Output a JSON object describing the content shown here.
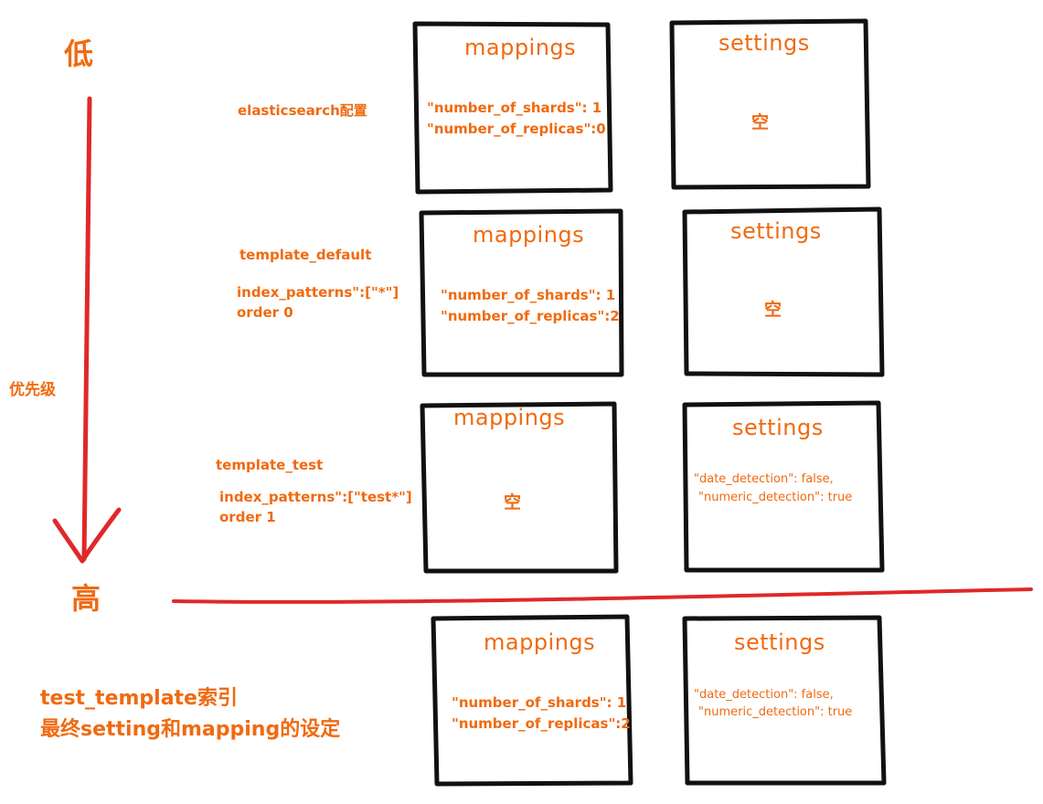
{
  "priority": {
    "low": "低",
    "high": "高",
    "label": "优先级"
  },
  "rows": [
    {
      "name": "elasticsearch配置",
      "details": [],
      "mappings": {
        "title": "mappings",
        "lines": [
          "\"number_of_shards\": 1",
          "\"number_of_replicas\":0"
        ]
      },
      "settings": {
        "title": "settings",
        "lines": [
          "空"
        ]
      }
    },
    {
      "name": "template_default",
      "details": [
        "index_patterns\":[\"*\"]",
        "order 0"
      ],
      "mappings": {
        "title": "mappings",
        "lines": [
          "\"number_of_shards\": 1",
          "\"number_of_replicas\":2"
        ]
      },
      "settings": {
        "title": "settings",
        "lines": [
          "空"
        ]
      }
    },
    {
      "name": "template_test",
      "details": [
        "index_patterns\":[\"test*\"]",
        "order 1"
      ],
      "mappings": {
        "title": "mappings",
        "lines": [
          "空"
        ]
      },
      "settings": {
        "title": "settings",
        "lines": [
          "\"date_detection\": false,",
          "\"numeric_detection\": true"
        ]
      }
    }
  ],
  "result": {
    "caption_line1": "test_template索引",
    "caption_line2": "最终setting和mapping的设定",
    "mappings": {
      "title": "mappings",
      "lines": [
        "\"number_of_shards\": 1",
        "\"number_of_replicas\":2"
      ]
    },
    "settings": {
      "title": "settings",
      "lines": [
        "\"date_detection\": false,",
        "\"numeric_detection\": true"
      ]
    }
  },
  "colors": {
    "text": "#f06a10",
    "box": "#111111",
    "arrow": "#e0282a"
  }
}
